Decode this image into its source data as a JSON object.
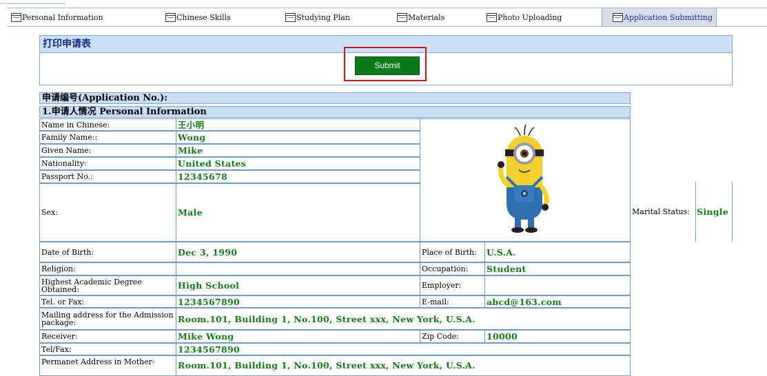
{
  "tabs": [
    {
      "label": "Personal Information"
    },
    {
      "label": "Chinese Skills"
    },
    {
      "label": "Studying Plan"
    },
    {
      "label": "Materials"
    },
    {
      "label": "Photo Uploading"
    },
    {
      "label": "Application Submitting",
      "active": true
    }
  ],
  "print_section": {
    "title": "打印申请表",
    "submit_label": "Submit"
  },
  "form": {
    "app_no_label": "申请编号(Application No.):",
    "section1_title": "1.申请人情况 Personal Information",
    "fields": {
      "name_cn": {
        "label": "Name in Chinese:",
        "value": "王小明"
      },
      "family_name": {
        "label": "Family Name::",
        "value": "Wong"
      },
      "given_name": {
        "label": "Given Name:",
        "value": "Mike"
      },
      "nationality": {
        "label": "Nationality:",
        "value": "United States"
      },
      "passport": {
        "label": "Passport No.:",
        "value": "12345678"
      },
      "sex": {
        "label": "Sex:",
        "value": "Male"
      },
      "marital": {
        "label": "Marital Status:",
        "value": "Single"
      },
      "dob": {
        "label": "Date of Birth:",
        "value": "Dec 3, 1990"
      },
      "pob": {
        "label": "Place of Birth:",
        "value": "U.S.A."
      },
      "religion": {
        "label": "Religion:",
        "value": ""
      },
      "occupation": {
        "label": "Occupation:",
        "value": "Student"
      },
      "degree": {
        "label": "Highest Academic Degree Obtained:",
        "value": "High School"
      },
      "employer": {
        "label": "Employer:",
        "value": ""
      },
      "tel": {
        "label": "Tel. or Fax:",
        "value": "1234567890"
      },
      "email": {
        "label": "E-mail:",
        "value": "abcd@163.com"
      },
      "mailing": {
        "label": "Mailing address for the Admission package:",
        "value": "Room.101, Building 1, No.100, Street xxx, New York, U.S.A."
      },
      "receiver": {
        "label": "Receiver:",
        "value": "Mike Wong"
      },
      "zip": {
        "label": "Zip Code:",
        "value": "10000"
      },
      "telfax": {
        "label": "Tel/Fax:",
        "value": "1234567890"
      },
      "permanent": {
        "label": "Permanet Address in Mother-",
        "value": "Room.101, Building 1, No.100, Street xxx, New York, U.S.A."
      }
    }
  },
  "colors": {
    "value_green": "#0e7f12",
    "submit_green": "#0b7b19",
    "header_blue": "#c8dcf4",
    "highlight_red": "#e0101a"
  },
  "icons": {
    "tab_icon": "window-icon",
    "photo": "applicant-photo"
  }
}
